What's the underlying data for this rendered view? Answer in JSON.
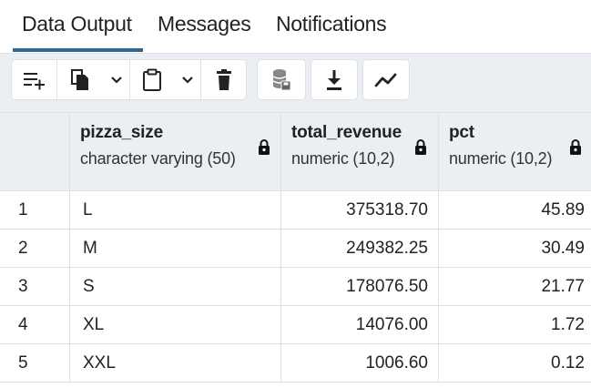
{
  "tabs": [
    {
      "label": "Data Output",
      "active": true
    },
    {
      "label": "Messages",
      "active": false
    },
    {
      "label": "Notifications",
      "active": false
    }
  ],
  "toolbar": {
    "buttons": [
      "add-row-icon",
      "copy-icon",
      "copy-options-chevron-icon",
      "paste-icon",
      "paste-options-chevron-icon",
      "delete-icon",
      "save-data-icon",
      "download-icon",
      "graph-icon"
    ]
  },
  "columns": [
    {
      "name": "pizza_size",
      "type": "character varying (50)",
      "locked": true
    },
    {
      "name": "total_revenue",
      "type": "numeric (10,2)",
      "locked": true
    },
    {
      "name": "pct",
      "type": "numeric (10,2)",
      "locked": true
    }
  ],
  "rows": [
    {
      "num": "1",
      "cells": [
        "L",
        "375318.70",
        "45.89"
      ]
    },
    {
      "num": "2",
      "cells": [
        "M",
        "249382.25",
        "30.49"
      ]
    },
    {
      "num": "3",
      "cells": [
        "S",
        "178076.50",
        "21.77"
      ]
    },
    {
      "num": "4",
      "cells": [
        "XL",
        "14076.00",
        "1.72"
      ]
    },
    {
      "num": "5",
      "cells": [
        "XXL",
        "1006.60",
        "0.12"
      ]
    }
  ],
  "colors": {
    "accent": "#326690",
    "toolbar_bg": "#ebeef3",
    "border": "#dde0e6",
    "icon": "#222222"
  }
}
